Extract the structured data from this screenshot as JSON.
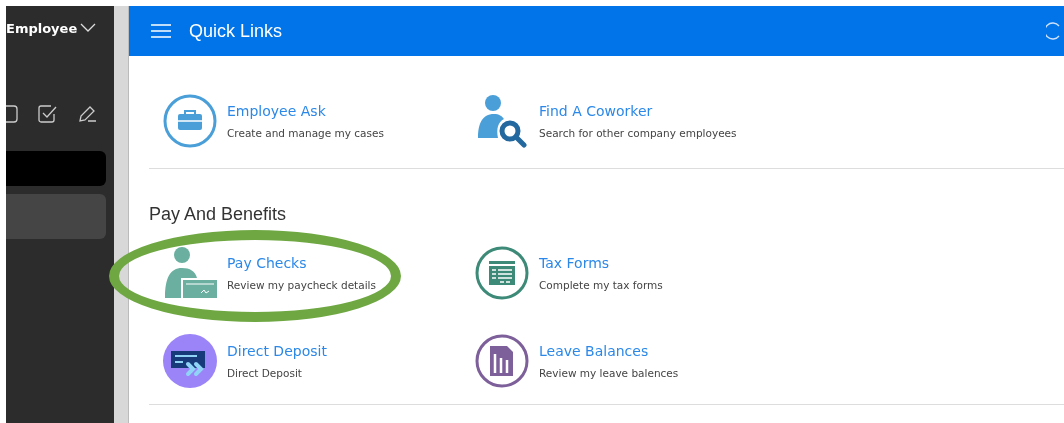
{
  "sidebar": {
    "title": "Employee"
  },
  "header": {
    "title": "Quick Links"
  },
  "sections": [
    {
      "items": [
        {
          "kind": "briefcase",
          "title": "Employee Ask",
          "description": "Create and manage my cases"
        },
        {
          "kind": "person-search",
          "title": "Find A Coworker",
          "description": "Search for other company employees"
        }
      ]
    },
    {
      "heading": "Pay And Benefits",
      "items": [
        {
          "kind": "person-check",
          "title": "Pay Checks",
          "description": "Review my paycheck details",
          "highlighted": true
        },
        {
          "kind": "form",
          "title": "Tax Forms",
          "description": "Complete my tax forms"
        },
        {
          "kind": "card",
          "title": "Direct Deposit",
          "description": "Direct Deposit"
        },
        {
          "kind": "document",
          "title": "Leave Balances",
          "description": "Review my leave balences"
        }
      ]
    }
  ]
}
